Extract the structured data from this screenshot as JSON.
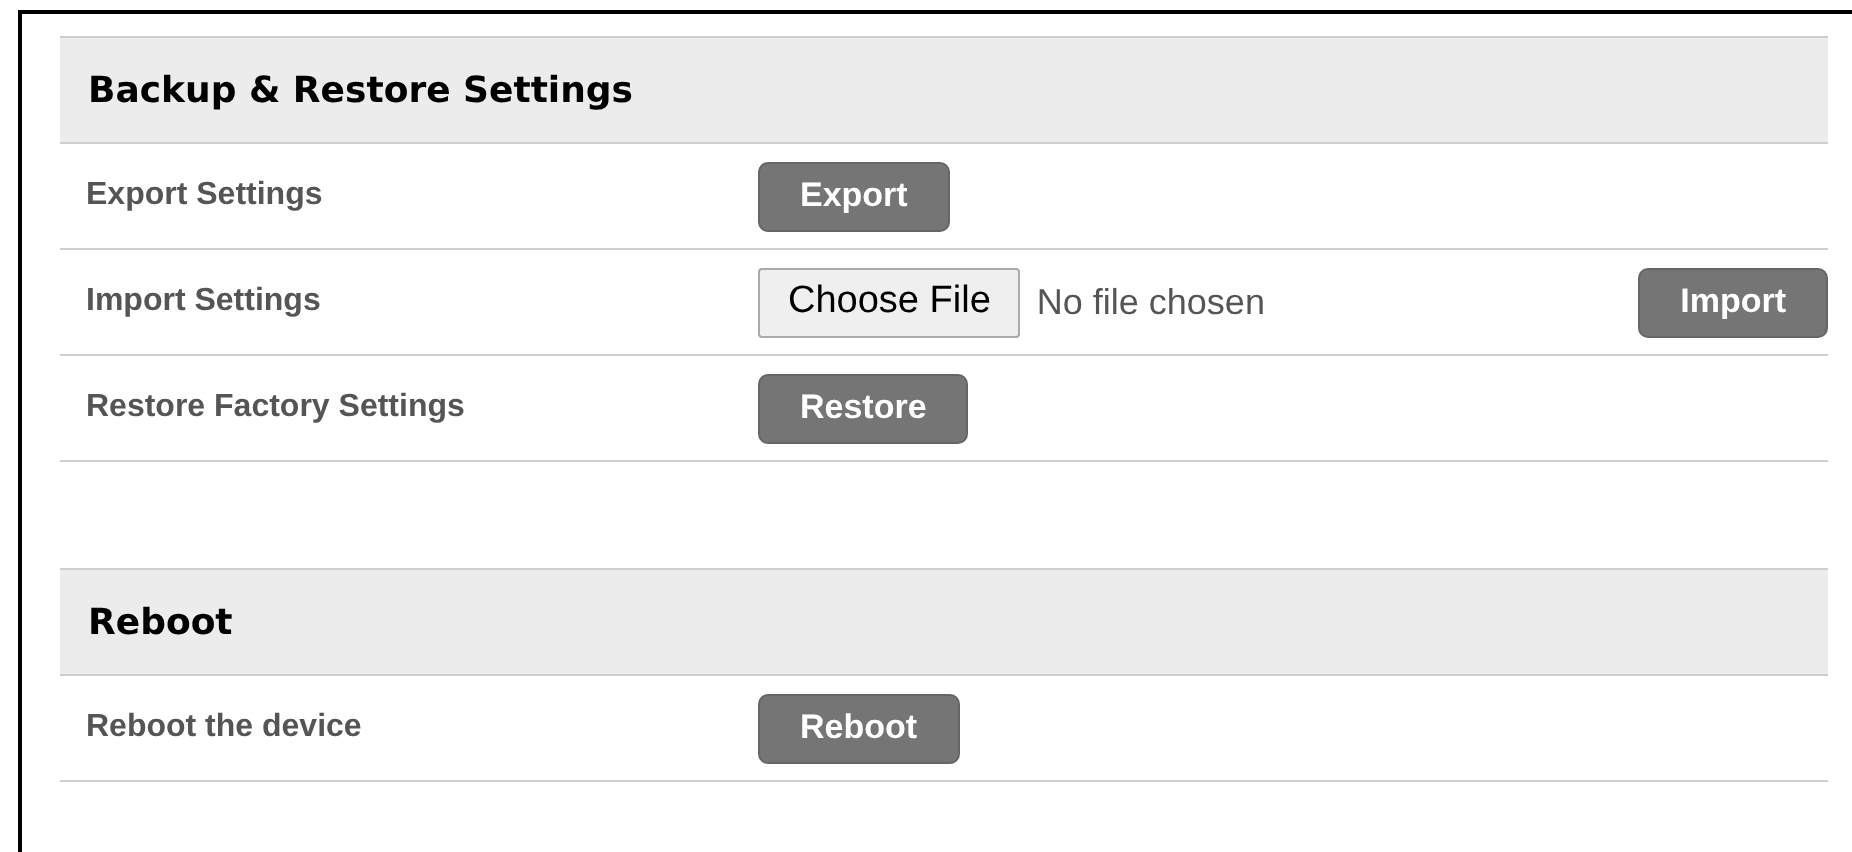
{
  "sections": [
    {
      "title": "Backup & Restore Settings",
      "rows": [
        {
          "kind": "button",
          "label": "Export Settings",
          "button": "Export"
        },
        {
          "kind": "file",
          "label": "Import Settings",
          "file_button": "Choose File",
          "file_status": "No file chosen",
          "button": "Import"
        },
        {
          "kind": "button",
          "label": "Restore Factory Settings",
          "button": "Restore"
        }
      ]
    },
    {
      "title": "Reboot",
      "rows": [
        {
          "kind": "button",
          "label": "Reboot the device",
          "button": "Reboot"
        }
      ]
    }
  ]
}
